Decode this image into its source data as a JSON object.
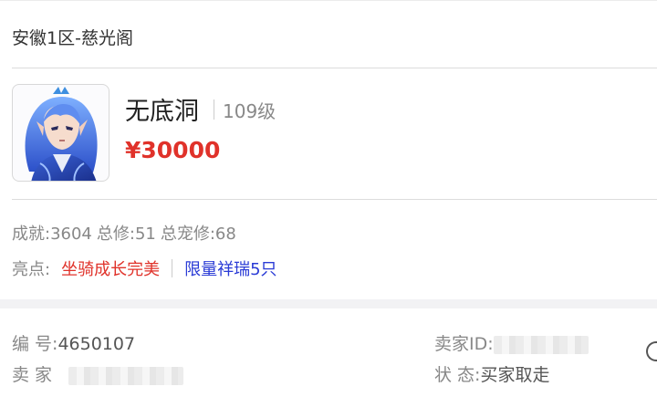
{
  "listing": {
    "server": "安徽1区-慈光阁",
    "role_name": "无底洞",
    "level": "109级",
    "price": "¥30000",
    "stats": {
      "achievement": "成就:3604",
      "total_cultivation": "总修:51",
      "pet_cultivation": "总宠修:68"
    },
    "highlights": {
      "label": "亮点:",
      "items": [
        "坐骑成长完美",
        "限量祥瑞5只"
      ]
    }
  },
  "details": {
    "serial_label": "编  号:",
    "serial_value": "4650107",
    "seller_id_label": "卖家ID:",
    "seller_label": "卖  家",
    "status_label": "状  态:",
    "status_value": "买家取走"
  },
  "colors": {
    "price": "#e0322a",
    "highlight_red": "#e0322a",
    "highlight_blue": "#2a3bd6"
  }
}
